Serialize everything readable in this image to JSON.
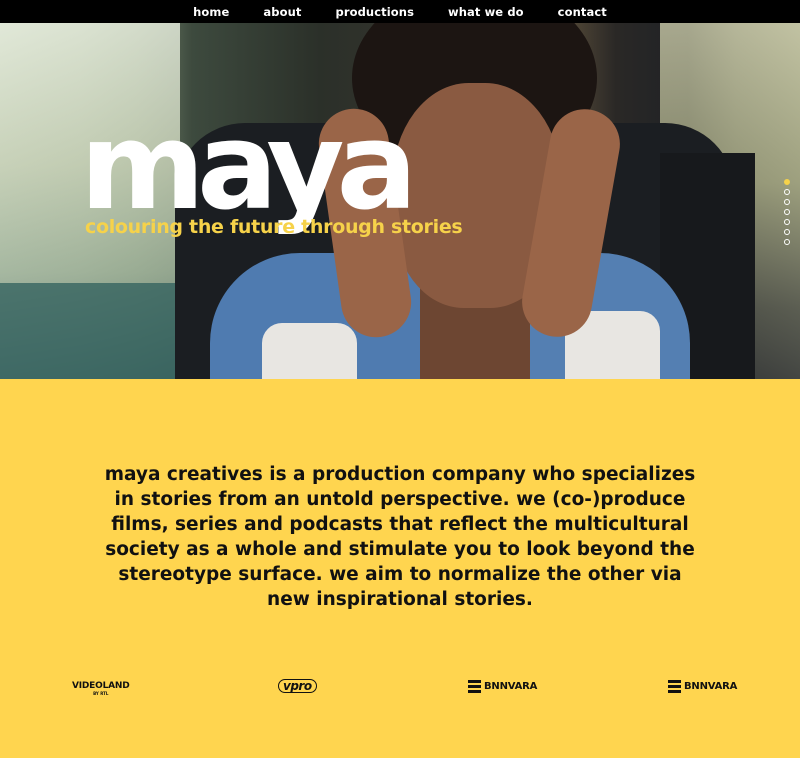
{
  "nav": {
    "items": [
      {
        "label": "home"
      },
      {
        "label": "about"
      },
      {
        "label": "productions"
      },
      {
        "label": "what we do"
      },
      {
        "label": "contact"
      }
    ]
  },
  "hero": {
    "title": "maya",
    "tagline": "colouring the future through stories",
    "slides": {
      "count": 7,
      "active_index": 0
    }
  },
  "about": {
    "text": "maya creatives is a production company who specializes in stories from an untold perspective. we (co-)produce films, series and podcasts that reflect the multicultural society as a whole and stimulate you to look beyond the stereotype surface. we aim to normalize the other via new inspirational stories."
  },
  "partners": {
    "videoland": {
      "name": "VIDEOLAND",
      "sub": "BY RTL"
    },
    "vpro": {
      "name": "vpro"
    },
    "bnnvara_1": {
      "name": "BNNVARA"
    },
    "bnnvara_2": {
      "name": "BNNVARA"
    }
  },
  "colors": {
    "accent": "#f6d24a",
    "background": "#ffd54f",
    "nav": "#000000"
  }
}
